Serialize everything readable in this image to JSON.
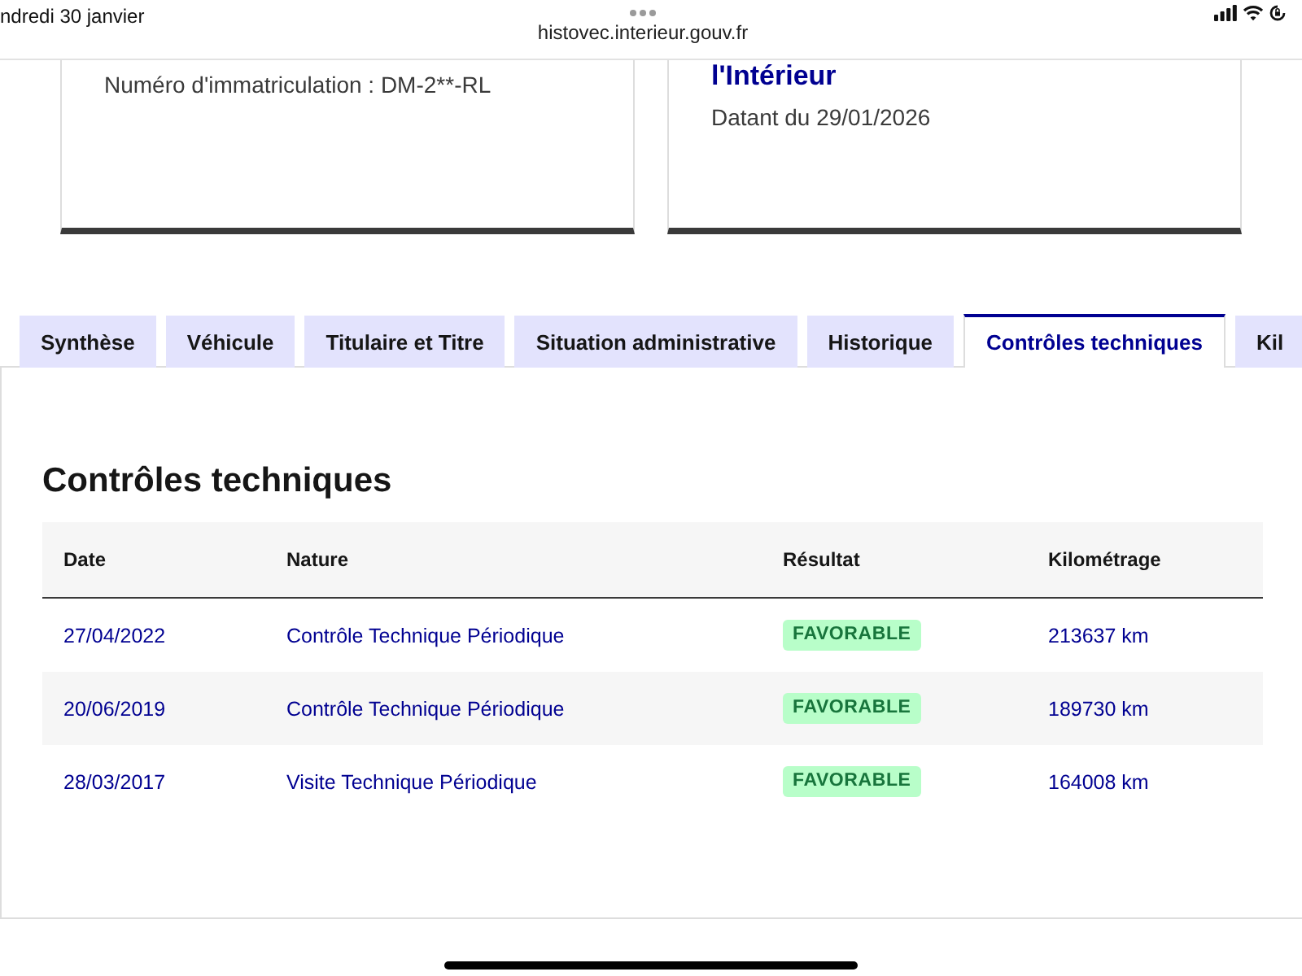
{
  "status_bar": {
    "date": "ndredi 30 janvier",
    "url": "histovec.interieur.gouv.fr"
  },
  "cards": [
    {
      "lines": [
        {
          "kind": "text",
          "text": "Numéro d'immatriculation : DM-2**-RL"
        }
      ]
    },
    {
      "lines": [
        {
          "kind": "title",
          "text": "l'Intérieur"
        },
        {
          "kind": "text",
          "text": "Datant du 29/01/2026"
        }
      ]
    }
  ],
  "tabs": [
    {
      "label": "Synthèse",
      "selected": false
    },
    {
      "label": "Véhicule",
      "selected": false
    },
    {
      "label": "Titulaire et Titre",
      "selected": false
    },
    {
      "label": "Situation administrative",
      "selected": false
    },
    {
      "label": "Historique",
      "selected": false
    },
    {
      "label": "Contrôles techniques",
      "selected": true
    },
    {
      "label": "Kil",
      "selected": false
    }
  ],
  "section": {
    "title": "Contrôles techniques",
    "table": {
      "columns": [
        "Date",
        "Nature",
        "Résultat",
        "Kilométrage"
      ],
      "rows": [
        {
          "date": "27/04/2022",
          "nature": "Contrôle Technique Périodique",
          "result": "FAVORABLE",
          "mileage": "213637 km"
        },
        {
          "date": "20/06/2019",
          "nature": "Contrôle Technique Périodique",
          "result": "FAVORABLE",
          "mileage": "189730 km"
        },
        {
          "date": "28/03/2017",
          "nature": "Visite Technique Périodique",
          "result": "FAVORABLE",
          "mileage": "164008 km"
        }
      ]
    }
  }
}
